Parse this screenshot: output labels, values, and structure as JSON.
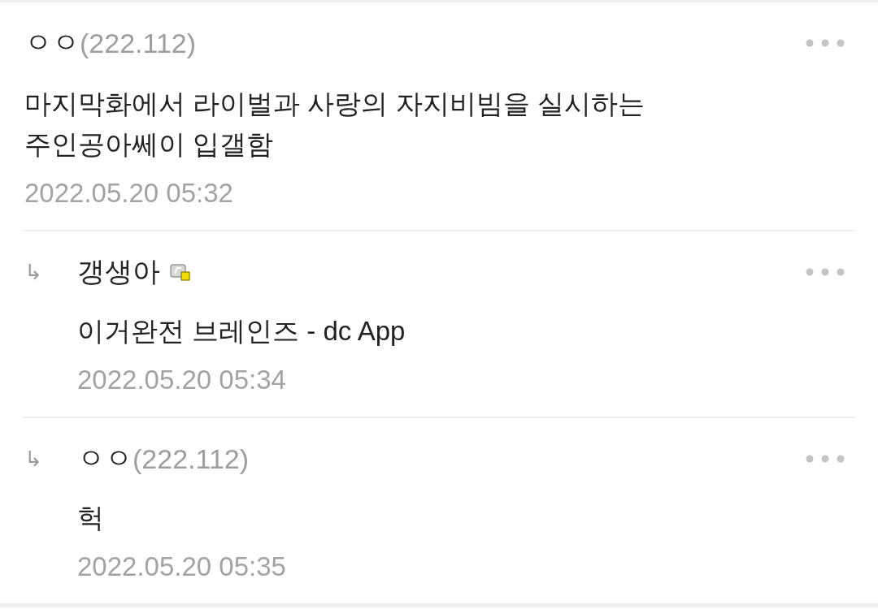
{
  "comments": [
    {
      "kind": "comment",
      "name": "ㅇㅇ",
      "ip": "(222.112)",
      "badge": false,
      "body": "마지막화에서 라이벌과 사랑의 자지비빔을 실시하는 주인공아쎄이 입갤함",
      "date": "2022.05.20 05:32"
    },
    {
      "kind": "reply",
      "reply_mark": "↳",
      "name": "갱생아",
      "badge": true,
      "body": "이거완전 브레인즈 - dc App",
      "date": "2022.05.20 05:34"
    },
    {
      "kind": "reply",
      "reply_mark": "↳",
      "name": "ㅇㅇ",
      "ip": "(222.112)",
      "badge": false,
      "body": "헉",
      "date": "2022.05.20 05:35"
    }
  ]
}
